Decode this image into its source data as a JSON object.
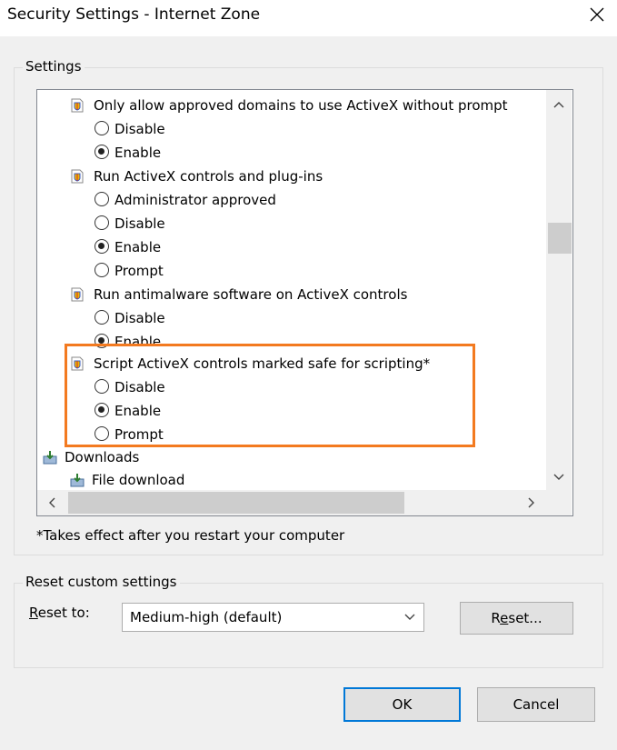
{
  "window": {
    "title": "Security Settings - Internet Zone"
  },
  "settings_group": {
    "label": "Settings"
  },
  "tree": {
    "s1": {
      "label": "Only allow approved domains to use ActiveX without prompt",
      "opt1": "Disable",
      "opt2": "Enable"
    },
    "s2": {
      "label": "Run ActiveX controls and plug-ins",
      "opt1": "Administrator approved",
      "opt2": "Disable",
      "opt3": "Enable",
      "opt4": "Prompt"
    },
    "s3": {
      "label": "Run antimalware software on ActiveX controls",
      "opt1": "Disable",
      "opt2": "Enable"
    },
    "s4": {
      "label": "Script ActiveX controls marked safe for scripting*",
      "opt1": "Disable",
      "opt2": "Enable",
      "opt3": "Prompt"
    },
    "downloads": {
      "label": "Downloads"
    },
    "file_download": {
      "label": "File download"
    }
  },
  "note": "*Takes effect after you restart your computer",
  "reset_group": {
    "label": "Reset custom settings",
    "reset_to_prefix": "R",
    "reset_to_rest": "eset to:",
    "selected": "Medium-high (default)",
    "reset_button_prefix": "R",
    "reset_button_accel": "e",
    "reset_button_rest": "set..."
  },
  "buttons": {
    "ok": "OK",
    "cancel": "Cancel"
  },
  "colors": {
    "highlight": "#f37a20",
    "default_button_border": "#0078d7"
  },
  "icons": {
    "setting": "shield-doc-icon",
    "downloads": "download-icon"
  }
}
